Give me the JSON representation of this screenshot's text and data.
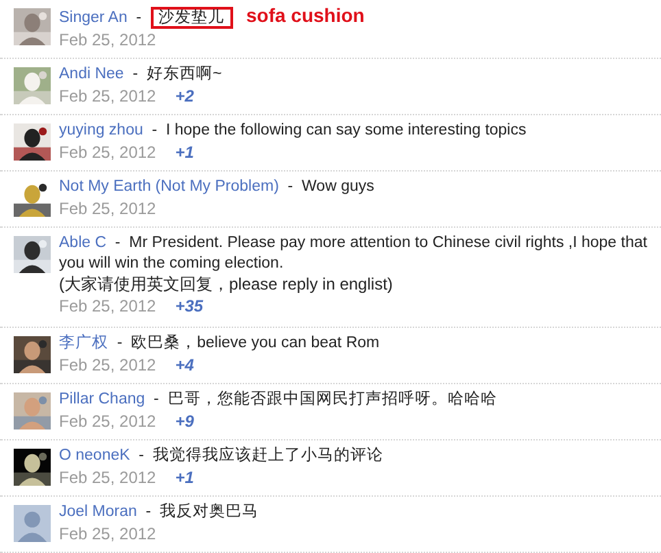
{
  "comments": [
    {
      "author": "Singer An",
      "separator": "-",
      "text": "沙发垫儿",
      "date": "Feb 25, 2012",
      "highlighted": true,
      "annotation": "sofa cushion"
    },
    {
      "author": "Andi Nee",
      "separator": "-",
      "text": "好东西啊~",
      "date": "Feb 25, 2012",
      "plus": "+2",
      "highlighted": false
    },
    {
      "author": "yuying zhou",
      "separator": "-",
      "text": "I hope the following can say some interesting topics",
      "date": "Feb 25, 2012",
      "plus": "+1",
      "highlighted": false
    },
    {
      "author": "Not My Earth (Not My Problem)",
      "separator": "-",
      "text": "Wow guys",
      "date": "Feb 25, 2012",
      "highlighted": false
    },
    {
      "author": "Able C",
      "separator": "-",
      "text": "Mr President. Please pay more attention to Chinese civil rights ,I hope that you will win the coming election.",
      "extra": "(大家请使用英文回复，please reply in englist)",
      "date": "Feb 25, 2012",
      "plus": "+35",
      "highlighted": false
    },
    {
      "author": "李广权",
      "separator": "-",
      "text": "欧巴桑，believe you can beat Rom",
      "date": "Feb 25, 2012",
      "plus": "+4",
      "highlighted": false
    },
    {
      "author": "Pillar Chang",
      "separator": "-",
      "text": "巴哥，您能否跟中国网民打声招呼呀。哈哈哈",
      "date": "Feb 25, 2012",
      "plus": "+9",
      "highlighted": false
    },
    {
      "author": "O neoneK",
      "separator": "-",
      "text": "我觉得我应该赶上了小马的评论",
      "date": "Feb 25, 2012",
      "plus": "+1",
      "highlighted": false
    },
    {
      "author": "Joel Moran",
      "separator": "-",
      "text": "我反对奥巴马",
      "date": "Feb 25, 2012",
      "highlighted": false,
      "avatar": {
        "kind": "default"
      }
    }
  ]
}
